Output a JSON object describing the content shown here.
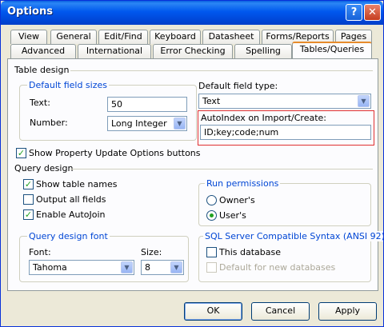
{
  "window": {
    "title": "Options"
  },
  "tabs_row1": [
    "View",
    "General",
    "Edit/Find",
    "Keyboard",
    "Datasheet",
    "Forms/Reports",
    "Pages"
  ],
  "tabs_row2": [
    "Advanced",
    "International",
    "Error Checking",
    "Spelling",
    "Tables/Queries"
  ],
  "table_design": {
    "heading": "Table design",
    "default_field_sizes": {
      "title": "Default field sizes",
      "text_label": "Text:",
      "text_value": "50",
      "number_label": "Number:",
      "number_value": "Long Integer"
    },
    "default_field_type": {
      "label": "Default field type:",
      "value": "Text"
    },
    "autoindex": {
      "label": "AutoIndex on Import/Create:",
      "value": "ID;key;code;num"
    },
    "show_property_update": {
      "label": "Show Property Update Options buttons",
      "checked": true
    }
  },
  "query_design": {
    "heading": "Query design",
    "show_table_names": {
      "label": "Show table names",
      "checked": true
    },
    "output_all_fields": {
      "label": "Output all fields",
      "checked": false
    },
    "enable_autojoin": {
      "label": "Enable AutoJoin",
      "checked": true
    },
    "run_permissions": {
      "title": "Run permissions",
      "owners": "Owner's",
      "users": "User's",
      "selected": "User's"
    },
    "font": {
      "title": "Query design font",
      "font_label": "Font:",
      "font_value": "Tahoma",
      "size_label": "Size:",
      "size_value": "8"
    },
    "sql_server": {
      "title": "SQL Server Compatible Syntax (ANSI 92)",
      "this_database": "This database",
      "default_new": "Default for new databases"
    }
  },
  "buttons": {
    "ok": "OK",
    "cancel": "Cancel",
    "apply": "Apply"
  },
  "colors": {
    "title_bar": "#0058ee",
    "dialog_bg": "#ece9d8",
    "group_title": "#0046d5",
    "highlight_border": "#e03030"
  }
}
